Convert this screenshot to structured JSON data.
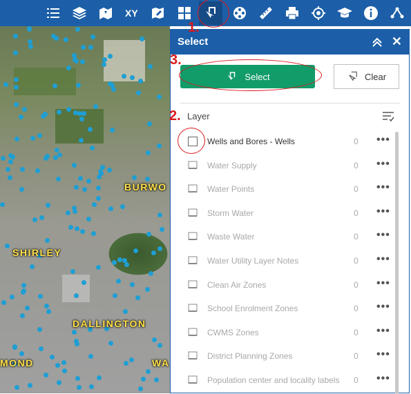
{
  "toolbar": {
    "tools": [
      {
        "name": "legend-icon"
      },
      {
        "name": "layers-icon"
      },
      {
        "name": "basemap-icon"
      },
      {
        "name": "coordinate-xy-icon"
      },
      {
        "name": "map-edit-icon"
      },
      {
        "name": "grid-icon"
      },
      {
        "name": "select-tool-icon",
        "active": true
      },
      {
        "name": "film-reel-icon"
      },
      {
        "name": "measure-ruler-icon"
      },
      {
        "name": "print-icon"
      },
      {
        "name": "locate-crosshair-icon"
      },
      {
        "name": "school-cap-icon"
      },
      {
        "name": "info-icon"
      },
      {
        "name": "share-icon"
      }
    ]
  },
  "map": {
    "labels": [
      "BURWO",
      "SHIRLEY",
      "DALLINGTON",
      "MOND",
      "WA"
    ],
    "colors": {
      "points": "#1e9fd4",
      "label": "#ffe14a"
    }
  },
  "panel": {
    "title": "Select",
    "select_label": "Select",
    "clear_label": "Clear",
    "layer_heading": "Layer",
    "layers": [
      {
        "label": "Wells and Bores - Wells",
        "count": "0"
      },
      {
        "label": "Water Supply",
        "count": "0"
      },
      {
        "label": "Water Points",
        "count": "0"
      },
      {
        "label": "Storm Water",
        "count": "0"
      },
      {
        "label": "Waste Water",
        "count": "0"
      },
      {
        "label": "Water Utility Layer Notes",
        "count": "0"
      },
      {
        "label": "Clean Air Zones",
        "count": "0"
      },
      {
        "label": "School Enrolment Zones",
        "count": "0"
      },
      {
        "label": "CWMS Zones",
        "count": "0"
      },
      {
        "label": "District Planning Zones",
        "count": "0"
      },
      {
        "label": "Population center and locality labels",
        "count": "0"
      }
    ],
    "more_symbol": "•••"
  },
  "annotations": [
    "1.",
    "2.",
    "3."
  ],
  "colors": {
    "header": "#1c5fa8",
    "select_button": "#129c6a",
    "annotation": "#d8191c"
  }
}
